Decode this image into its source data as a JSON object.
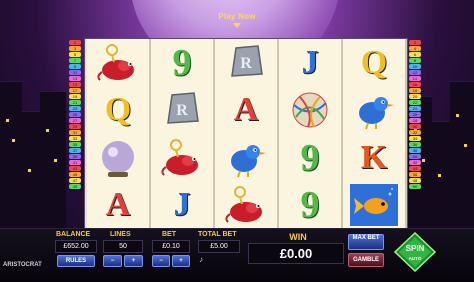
{
  "header": {
    "play_now": "Play Now"
  },
  "paylines_left": [
    "1",
    "3",
    "5",
    "7",
    "9",
    "11",
    "13",
    "15",
    "17",
    "19",
    "21",
    "23",
    "25",
    "27",
    "29",
    "31",
    "33",
    "35",
    "37",
    "39",
    "41",
    "43",
    "45",
    "47",
    "49"
  ],
  "paylines_right": [
    "2",
    "4",
    "6",
    "8",
    "10",
    "12",
    "14",
    "16",
    "18",
    "20",
    "22",
    "24",
    "26",
    "28",
    "30",
    "32",
    "34",
    "36",
    "38",
    "40",
    "42",
    "44",
    "46",
    "48",
    "50"
  ],
  "reels": [
    [
      {
        "kind": "icon",
        "name": "mouse-clock-icon"
      },
      {
        "kind": "letter",
        "text": "Q",
        "color": "#f0c020"
      },
      {
        "kind": "icon",
        "name": "crystal-ball-icon"
      },
      {
        "kind": "letter",
        "text": "A",
        "color": "#e0403a"
      }
    ],
    [
      {
        "kind": "number",
        "text": "9"
      },
      {
        "kind": "icon",
        "name": "rock-block-icon"
      },
      {
        "kind": "icon",
        "name": "mouse-clock-icon"
      },
      {
        "kind": "letter",
        "text": "J",
        "color": "#2e6fd8"
      }
    ],
    [
      {
        "kind": "icon",
        "name": "rock-block-icon"
      },
      {
        "kind": "letter",
        "text": "A",
        "color": "#e0403a"
      },
      {
        "kind": "icon",
        "name": "bluebird-icon"
      },
      {
        "kind": "icon",
        "name": "mouse-clock-icon"
      }
    ],
    [
      {
        "kind": "letter",
        "text": "J",
        "color": "#2e6fd8"
      },
      {
        "kind": "icon",
        "name": "yarn-ball-icon"
      },
      {
        "kind": "number",
        "text": "9"
      },
      {
        "kind": "number",
        "text": "9"
      }
    ],
    [
      {
        "kind": "letter",
        "text": "Q",
        "color": "#f0c020"
      },
      {
        "kind": "icon",
        "name": "bluebird-icon"
      },
      {
        "kind": "letter",
        "text": "K",
        "color": "#e8551e"
      },
      {
        "kind": "icon",
        "name": "goldfish-icon"
      }
    ]
  ],
  "panel": {
    "balance_label": "BALANCE",
    "balance_value": "£652.00",
    "rules_label": "RULES",
    "lines_label": "LINES",
    "lines_value": "50",
    "bet_label": "BET",
    "bet_value": "£0.10",
    "total_bet_label": "TOTAL BET",
    "total_bet_value": "£5.00",
    "win_label": "WIN",
    "win_value": "£0.00",
    "max_bet_label": "MAX BET",
    "gamble_label": "GAMBLE",
    "spin_label": "SPIN",
    "auto_label": "AUTO",
    "minus": "−",
    "plus": "+",
    "logo_text": "ARISTOCRAT"
  }
}
